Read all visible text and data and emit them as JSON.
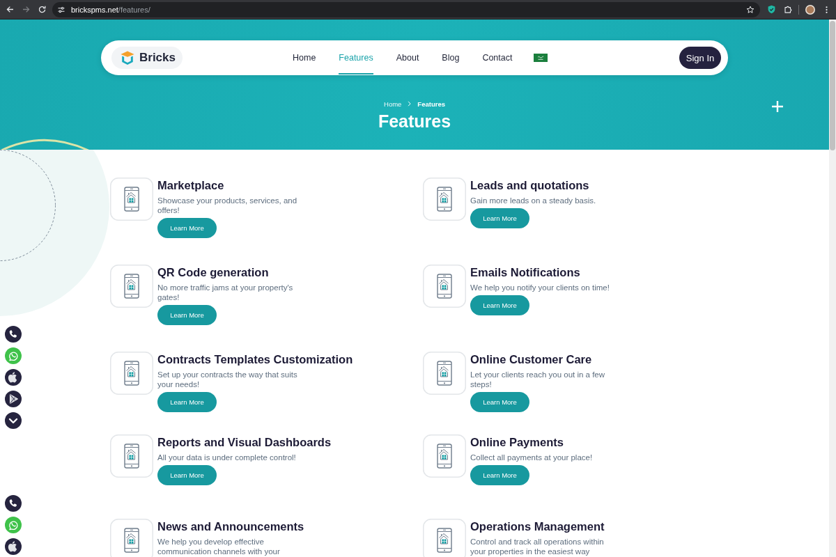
{
  "browser": {
    "url_host": "brickspms.net",
    "url_path": "/features/"
  },
  "nav": {
    "logo": "Bricks",
    "links": [
      {
        "label": "Home",
        "selected": false
      },
      {
        "label": "Features",
        "selected": true
      },
      {
        "label": "About",
        "selected": false
      },
      {
        "label": "Blog",
        "selected": false
      },
      {
        "label": "Contact",
        "selected": false
      }
    ],
    "sign_in": "Sign In"
  },
  "hero": {
    "breadcrumb": [
      {
        "label": "Home",
        "current": false
      },
      {
        "label": "Features",
        "current": true
      }
    ],
    "title": "Features"
  },
  "features": [
    {
      "title": "Marketplace",
      "description": "Showcase your products, services, and offers!",
      "button": "Learn More"
    },
    {
      "title": "Leads and quotations",
      "description": "Gain more leads on a steady basis.",
      "button": "Learn More"
    },
    {
      "title": "QR Code generation",
      "description": "No more traffic jams at your property's gates!",
      "button": "Learn More"
    },
    {
      "title": "Emails Notifications",
      "description": "We help you notify your clients on time!",
      "button": "Learn More"
    },
    {
      "title": "Contracts Templates Customization",
      "description": "Set up your contracts the way that suits your needs!",
      "button": "Learn More"
    },
    {
      "title": "Online Customer Care",
      "description": "Let your clients reach you out in a few steps!",
      "button": "Learn More"
    },
    {
      "title": "Reports and Visual Dashboards",
      "description": "All your data is under complete control!",
      "button": "Learn More"
    },
    {
      "title": "Online Payments",
      "description": "Collect all payments at your place!",
      "button": "Learn More"
    },
    {
      "title": "News and Announcements",
      "description": "We help you develop effective communication channels with your"
    },
    {
      "title": "Operations Management",
      "description": "Control and track all operations within your properties in the easiest way"
    }
  ],
  "side_buttons": [
    {
      "kind": "phone"
    },
    {
      "kind": "whatsapp"
    },
    {
      "kind": "apple"
    },
    {
      "kind": "play"
    },
    {
      "kind": "scroll-down"
    }
  ],
  "side_buttons_lower": [
    {
      "kind": "phone"
    },
    {
      "kind": "whatsapp"
    },
    {
      "kind": "apple"
    }
  ]
}
